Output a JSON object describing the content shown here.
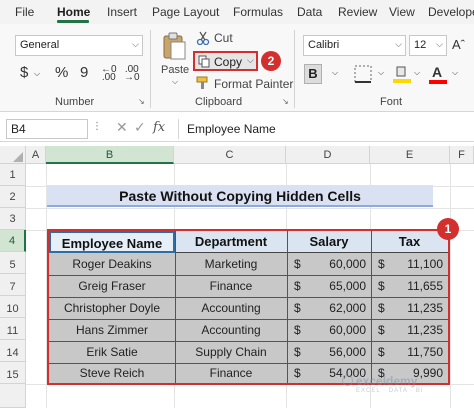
{
  "tabs": [
    "File",
    "Home",
    "Insert",
    "Page Layout",
    "Formulas",
    "Data",
    "Review",
    "View",
    "Developer"
  ],
  "number_group": {
    "format_value": "General",
    "currency_symbol": "$",
    "percent_symbol": "%",
    "comma_symbol": "9",
    "label": "Number"
  },
  "clipboard": {
    "paste_label": "Paste",
    "cut_label": "Cut",
    "copy_label": "Copy",
    "format_painter_label": "Format Painter",
    "label": "Clipboard",
    "step_badge": "2"
  },
  "font_group": {
    "font_name": "Calibri",
    "font_size": "12",
    "bold_label": "B",
    "label": "Font"
  },
  "formula_bar": {
    "name_box": "B4",
    "fx": "fx",
    "content": "Employee Name"
  },
  "columns": [
    "A",
    "B",
    "C",
    "D",
    "E",
    "F"
  ],
  "rows": [
    "1",
    "2",
    "3",
    "4",
    "5",
    "7",
    "10",
    "11",
    "14",
    "15"
  ],
  "title": "Paste Without Copying Hidden Cells",
  "table_badge": "1",
  "table": {
    "headers": [
      "Employee Name",
      "Department",
      "Salary",
      "Tax"
    ],
    "currency": "$",
    "rows": [
      {
        "name": "Roger Deakins",
        "dept": "Marketing",
        "salary": "60,000",
        "tax": "11,100"
      },
      {
        "name": "Greig Fraser",
        "dept": "Finance",
        "salary": "65,000",
        "tax": "11,655"
      },
      {
        "name": "Christopher Doyle",
        "dept": "Accounting",
        "salary": "62,000",
        "tax": "11,235"
      },
      {
        "name": "Hans Zimmer",
        "dept": "Accounting",
        "salary": "60,000",
        "tax": "11,235"
      },
      {
        "name": "Erik Satie",
        "dept": "Supply Chain",
        "salary": "56,000",
        "tax": "11,750"
      },
      {
        "name": "Steve Reich",
        "dept": "Finance",
        "salary": "54,000",
        "tax": "9,990"
      }
    ]
  },
  "watermark": {
    "brand": "exceldemy",
    "tagline": "EXCEL · DATA · BI"
  },
  "colors": {
    "accent": "#217346",
    "badge": "#d32f2f",
    "table_header": "#dbe5f1",
    "table_body": "#c8c8c8",
    "title_fill": "#d9e1f2"
  }
}
